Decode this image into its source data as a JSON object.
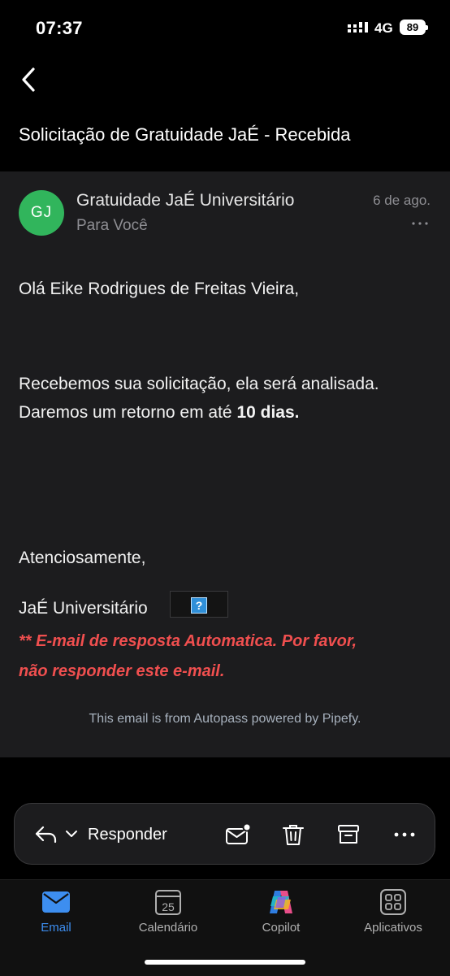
{
  "status_bar": {
    "time": "07:37",
    "network": "4G",
    "battery": "89"
  },
  "email": {
    "subject": "Solicitação de Gratuidade JaÉ - Recebida",
    "avatar_initials": "GJ",
    "avatar_color": "#31b55c",
    "sender": "Gratuidade JaÉ Universitário",
    "recipient": "Para Você",
    "date": "6 de ago.",
    "greeting": "Olá Eike Rodrigues de Freitas Vieira,",
    "message_line1": "Recebemos sua solicitação, ela será analisada.",
    "message_line2_prefix": "Daremos um retorno em até ",
    "message_line2_bold": "10 dias.",
    "regards": "Atenciosamente,",
    "signature": "JaÉ Universitário",
    "broken_image_glyph": "?",
    "warning_line1": "** E-mail de resposta Automatica. Por favor,",
    "warning_line2": "não responder este e-mail.",
    "warning_color": "#f04f4f",
    "footer_note": "This email is from Autopass powered by Pipefy."
  },
  "action_bar": {
    "reply_label": "Responder",
    "icons": [
      "reply-icon",
      "chevron-down-icon",
      "mark-unread-icon",
      "trash-icon",
      "archive-icon",
      "more-icon"
    ]
  },
  "tab_bar": {
    "tabs": [
      {
        "label": "Email",
        "icon": "mail-icon",
        "active": true
      },
      {
        "label": "Calendário",
        "icon": "calendar-icon",
        "date": "25",
        "active": false
      },
      {
        "label": "Copilot",
        "icon": "copilot-icon",
        "active": false
      },
      {
        "label": "Aplicativos",
        "icon": "apps-icon",
        "active": false
      }
    ],
    "accent_color": "#3d8ef0"
  }
}
